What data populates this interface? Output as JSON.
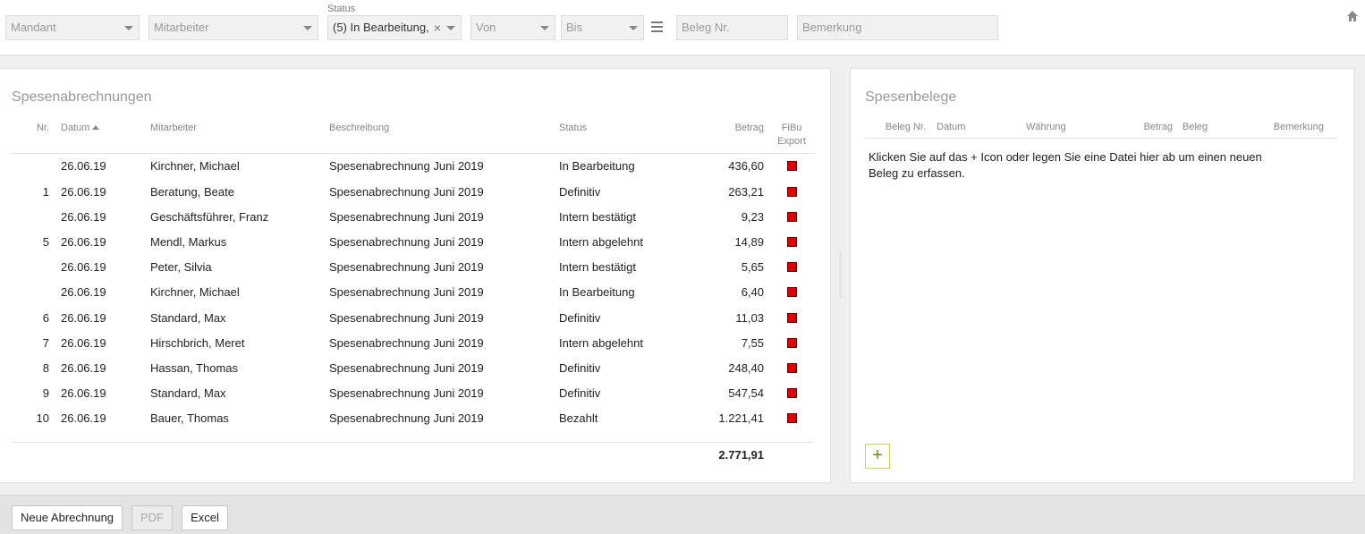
{
  "filters": {
    "mandant": "Mandant",
    "mitarbeiter": "Mitarbeiter",
    "status_label": "Status",
    "status_value": "(5) In Bearbeitung,",
    "clear": "×",
    "von": "Von",
    "bis": "Bis",
    "beleg_nr": "Beleg Nr.",
    "bemerkung": "Bemerkung"
  },
  "left_panel": {
    "title": "Spesenabrechnungen",
    "columns": {
      "nr": "Nr.",
      "datum": "Datum",
      "mitarbeiter": "Mitarbeiter",
      "beschreibung": "Beschreibung",
      "status": "Status",
      "betrag": "Betrag",
      "fibu1": "FiBu",
      "fibu2": "Export"
    },
    "rows": [
      {
        "nr": "",
        "datum": "26.06.19",
        "mitarbeiter": "Kirchner, Michael",
        "beschreibung": "Spesenabrechnung Juni 2019",
        "status": "In Bearbeitung",
        "betrag": "436,60"
      },
      {
        "nr": "1",
        "datum": "26.06.19",
        "mitarbeiter": "Beratung, Beate",
        "beschreibung": "Spesenabrechnung Juni 2019",
        "status": "Definitiv",
        "betrag": "263,21"
      },
      {
        "nr": "",
        "datum": "26.06.19",
        "mitarbeiter": "Geschäftsführer, Franz",
        "beschreibung": "Spesenabrechnung Juni 2019",
        "status": "Intern bestätigt",
        "betrag": "9,23"
      },
      {
        "nr": "5",
        "datum": "26.06.19",
        "mitarbeiter": "Mendl, Markus",
        "beschreibung": "Spesenabrechnung Juni 2019",
        "status": "Intern abgelehnt",
        "betrag": "14,89"
      },
      {
        "nr": "",
        "datum": "26.06.19",
        "mitarbeiter": "Peter, Silvia",
        "beschreibung": "Spesenabrechnung Juni 2019",
        "status": "Intern bestätigt",
        "betrag": "5,65"
      },
      {
        "nr": "",
        "datum": "26.06.19",
        "mitarbeiter": "Kirchner, Michael",
        "beschreibung": "Spesenabrechnung Juni 2019",
        "status": "In Bearbeitung",
        "betrag": "6,40"
      },
      {
        "nr": "6",
        "datum": "26.06.19",
        "mitarbeiter": "Standard, Max",
        "beschreibung": "Spesenabrechnung Juni 2019",
        "status": "Definitiv",
        "betrag": "11,03"
      },
      {
        "nr": "7",
        "datum": "26.06.19",
        "mitarbeiter": "Hirschbrich, Meret",
        "beschreibung": "Spesenabrechnung Juni 2019",
        "status": "Intern abgelehnt",
        "betrag": "7,55"
      },
      {
        "nr": "8",
        "datum": "26.06.19",
        "mitarbeiter": "Hassan, Thomas",
        "beschreibung": "Spesenabrechnung Juni 2019",
        "status": "Definitiv",
        "betrag": "248,40"
      },
      {
        "nr": "9",
        "datum": "26.06.19",
        "mitarbeiter": "Standard, Max",
        "beschreibung": "Spesenabrechnung Juni 2019",
        "status": "Definitiv",
        "betrag": "547,54"
      },
      {
        "nr": "10",
        "datum": "26.06.19",
        "mitarbeiter": "Bauer, Thomas",
        "beschreibung": "Spesenabrechnung Juni 2019",
        "status": "Bezahlt",
        "betrag": "1.221,41"
      }
    ],
    "total": "2.771,91"
  },
  "right_panel": {
    "title": "Spesenbelege",
    "columns": {
      "beleg_nr": "Beleg Nr.",
      "datum": "Datum",
      "waehrung": "Währung",
      "betrag": "Betrag",
      "beleg": "Beleg",
      "bemerkung": "Bemerkung"
    },
    "hint": "Klicken Sie auf das + Icon oder legen Sie eine Datei hier ab um einen neuen Beleg zu erfassen.",
    "add_label": "+"
  },
  "bottom": {
    "new_label": "Neue Abrechnung",
    "pdf_label": "PDF",
    "excel_label": "Excel"
  },
  "colors": {
    "fibu_flag": "#e00000",
    "add_border": "#c9d24a"
  },
  "icons": {
    "menu": "menu-icon",
    "home": "home-icon"
  }
}
